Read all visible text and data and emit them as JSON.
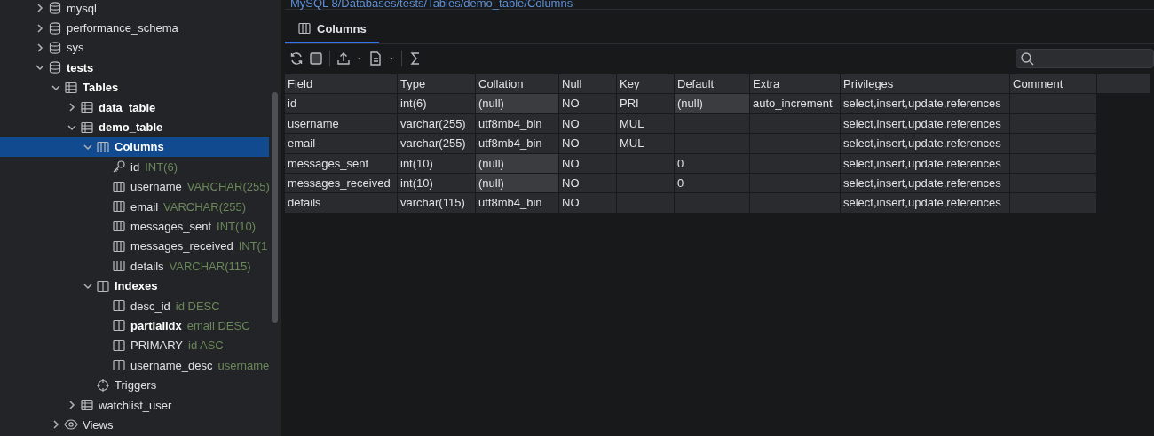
{
  "tree": [
    {
      "kind": "db",
      "name": "mysql",
      "selected": false,
      "expanded": false
    },
    {
      "kind": "db",
      "name": "performance_schema",
      "selected": false,
      "expanded": false
    },
    {
      "kind": "db",
      "name": "sys",
      "selected": false,
      "expanded": false
    },
    {
      "kind": "db",
      "name": "tests",
      "bold": true,
      "selected": false,
      "expanded": true,
      "children": [
        {
          "kind": "table",
          "name": "Tables",
          "bold": true,
          "selected": false,
          "expanded": true,
          "children": [
            {
              "kind": "table",
              "name": "data_table",
              "bold": true,
              "selected": false,
              "expanded": false
            },
            {
              "kind": "table",
              "name": "demo_table",
              "bold": true,
              "selected": false,
              "expanded": true,
              "children": [
                {
                  "kind": "columns",
                  "name": "Columns",
                  "bold": true,
                  "selected": true,
                  "expanded": true,
                  "children": [
                    {
                      "kind": "key",
                      "name": "id",
                      "detail": "INT(6)",
                      "selected": false
                    },
                    {
                      "kind": "columns",
                      "name": "username",
                      "detail": "VARCHAR(255)",
                      "selected": false
                    },
                    {
                      "kind": "columns",
                      "name": "email",
                      "detail": "VARCHAR(255)",
                      "selected": false
                    },
                    {
                      "kind": "columns",
                      "name": "messages_sent",
                      "detail": "INT(10)",
                      "selected": false
                    },
                    {
                      "kind": "columns",
                      "name": "messages_received",
                      "detail": "INT(1",
                      "selected": false
                    },
                    {
                      "kind": "columns",
                      "name": "details",
                      "detail": "VARCHAR(115)",
                      "selected": false
                    }
                  ]
                },
                {
                  "kind": "index",
                  "name": "Indexes",
                  "bold": true,
                  "selected": false,
                  "expanded": true,
                  "children": [
                    {
                      "kind": "index",
                      "name": "desc_id",
                      "detail": "id DESC",
                      "selected": false
                    },
                    {
                      "kind": "index",
                      "name": "partialidx",
                      "bold": true,
                      "detail": "email DESC",
                      "selected": false
                    },
                    {
                      "kind": "index",
                      "name": "PRIMARY",
                      "detail": "id ASC",
                      "selected": false
                    },
                    {
                      "kind": "index",
                      "name": "username_desc",
                      "detail": "username",
                      "selected": false
                    }
                  ]
                },
                {
                  "kind": "triggers",
                  "name": "Triggers",
                  "selected": false
                }
              ]
            },
            {
              "kind": "table",
              "name": "watchlist_user",
              "selected": false,
              "expanded": false
            }
          ]
        },
        {
          "kind": "views",
          "name": "Views",
          "selected": false,
          "expanded": false
        }
      ]
    }
  ],
  "breadcrumb": "MySQL 8/Databases/tests/Tables/demo_table/Columns",
  "tabs": [
    {
      "label": "Columns",
      "selected": true
    }
  ],
  "table": {
    "columns": [
      "Field",
      "Type",
      "Collation",
      "Null",
      "Key",
      "Default",
      "Extra",
      "Privileges",
      "Comment"
    ],
    "rows": [
      {
        "cells": [
          "id",
          "int(6)",
          {
            "text": "(null)",
            "shaded": true
          },
          "NO",
          "PRI",
          {
            "text": "(null)",
            "shaded": true
          },
          "auto_increment",
          "select,insert,update,references",
          null
        ]
      },
      {
        "cells": [
          "username",
          "varchar(255)",
          "utf8mb4_bin",
          "NO",
          "MUL",
          null,
          null,
          "select,insert,update,references",
          null
        ]
      },
      {
        "cells": [
          "email",
          "varchar(255)",
          "utf8mb4_bin",
          "NO",
          "MUL",
          null,
          null,
          "select,insert,update,references",
          null
        ]
      },
      {
        "cells": [
          "messages_sent",
          "int(10)",
          {
            "text": "(null)",
            "shaded": true
          },
          "NO",
          null,
          "0",
          null,
          "select,insert,update,references",
          null
        ]
      },
      {
        "cells": [
          "messages_received",
          "int(10)",
          {
            "text": "(null)",
            "shaded": true
          },
          "NO",
          null,
          "0",
          null,
          "select,insert,update,references",
          null
        ]
      },
      {
        "cells": [
          "details",
          "varchar(115)",
          "utf8mb4_bin",
          "NO",
          null,
          null,
          null,
          "select,insert,update,references",
          null
        ]
      }
    ]
  }
}
